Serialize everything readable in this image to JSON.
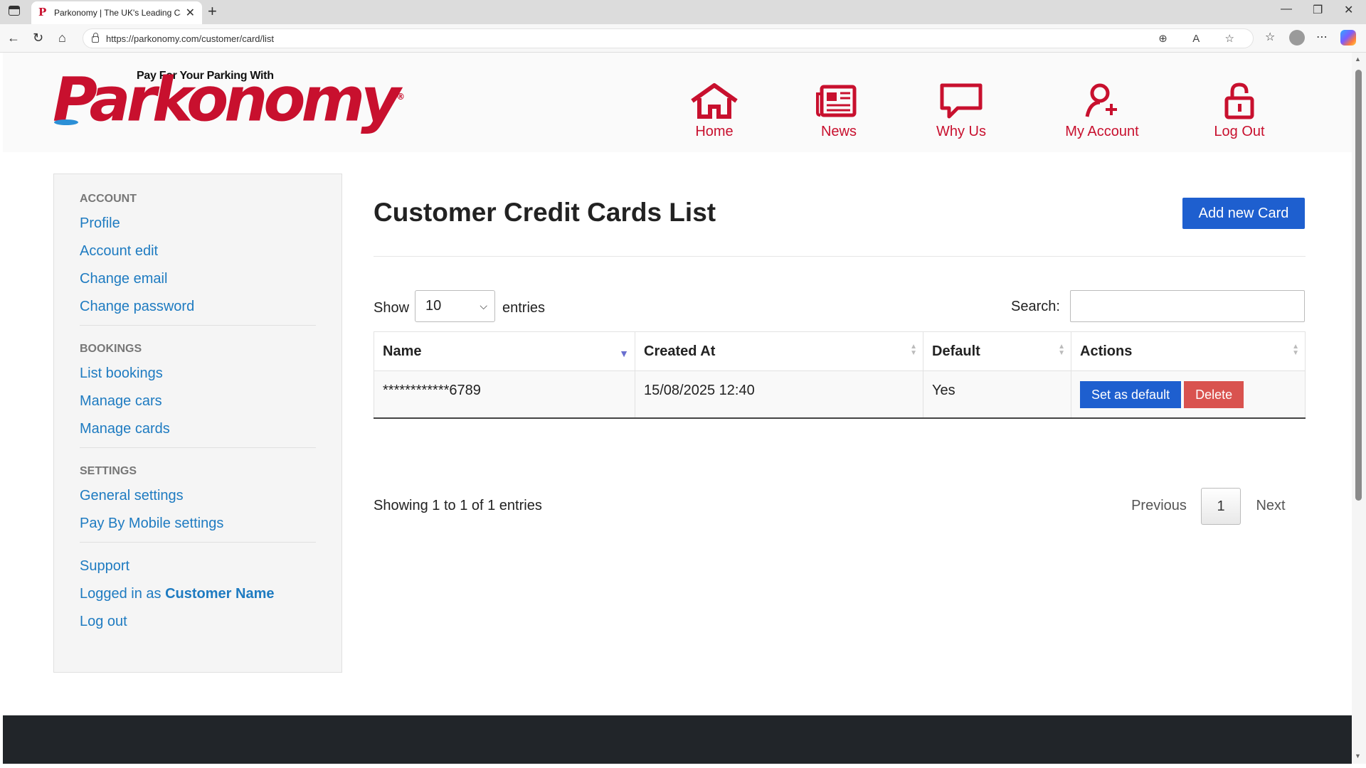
{
  "browser": {
    "tab_title": "Parkonomy | The UK's Leading Ca",
    "tab_favicon": "P",
    "url": "https://parkonomy.com/customer/card/list"
  },
  "logo": {
    "tagline": "Pay For Your Parking With",
    "brand": "Parkonomy",
    "registered": "®"
  },
  "nav": {
    "home": "Home",
    "news": "News",
    "why_us": "Why Us",
    "my_account": "My Account",
    "log_out": "Log Out"
  },
  "sidebar": {
    "account_heading": "ACCOUNT",
    "account_links": [
      "Profile",
      "Account edit",
      "Change email",
      "Change password"
    ],
    "bookings_heading": "BOOKINGS",
    "bookings_links": [
      "List bookings",
      "Manage cars",
      "Manage cards"
    ],
    "settings_heading": "SETTINGS",
    "settings_links": [
      "General settings",
      "Pay By Mobile settings"
    ],
    "support": "Support",
    "logged_in_prefix": "Logged in as ",
    "customer_name": "Customer Name",
    "log_out": "Log out"
  },
  "main": {
    "title": "Customer Credit Cards List",
    "add_button": "Add new Card",
    "show_label": "Show",
    "page_size": "10",
    "entries_label": "entries",
    "search_label": "Search:",
    "search_value": "",
    "columns": [
      "Name",
      "Created At",
      "Default",
      "Actions"
    ],
    "rows": [
      {
        "name": "************6789",
        "created_at": "15/08/2025 12:40",
        "default": "Yes"
      }
    ],
    "set_default_button": "Set as default",
    "delete_button": "Delete",
    "info": "Showing 1 to 1 of 1 entries",
    "pager": {
      "previous": "Previous",
      "current": "1",
      "next": "Next"
    }
  },
  "colors": {
    "brand_red": "#c8102e",
    "link_blue": "#1e7bc1",
    "button_blue": "#1e5fcf",
    "delete_red": "#d9534f",
    "footer": "#212529"
  }
}
